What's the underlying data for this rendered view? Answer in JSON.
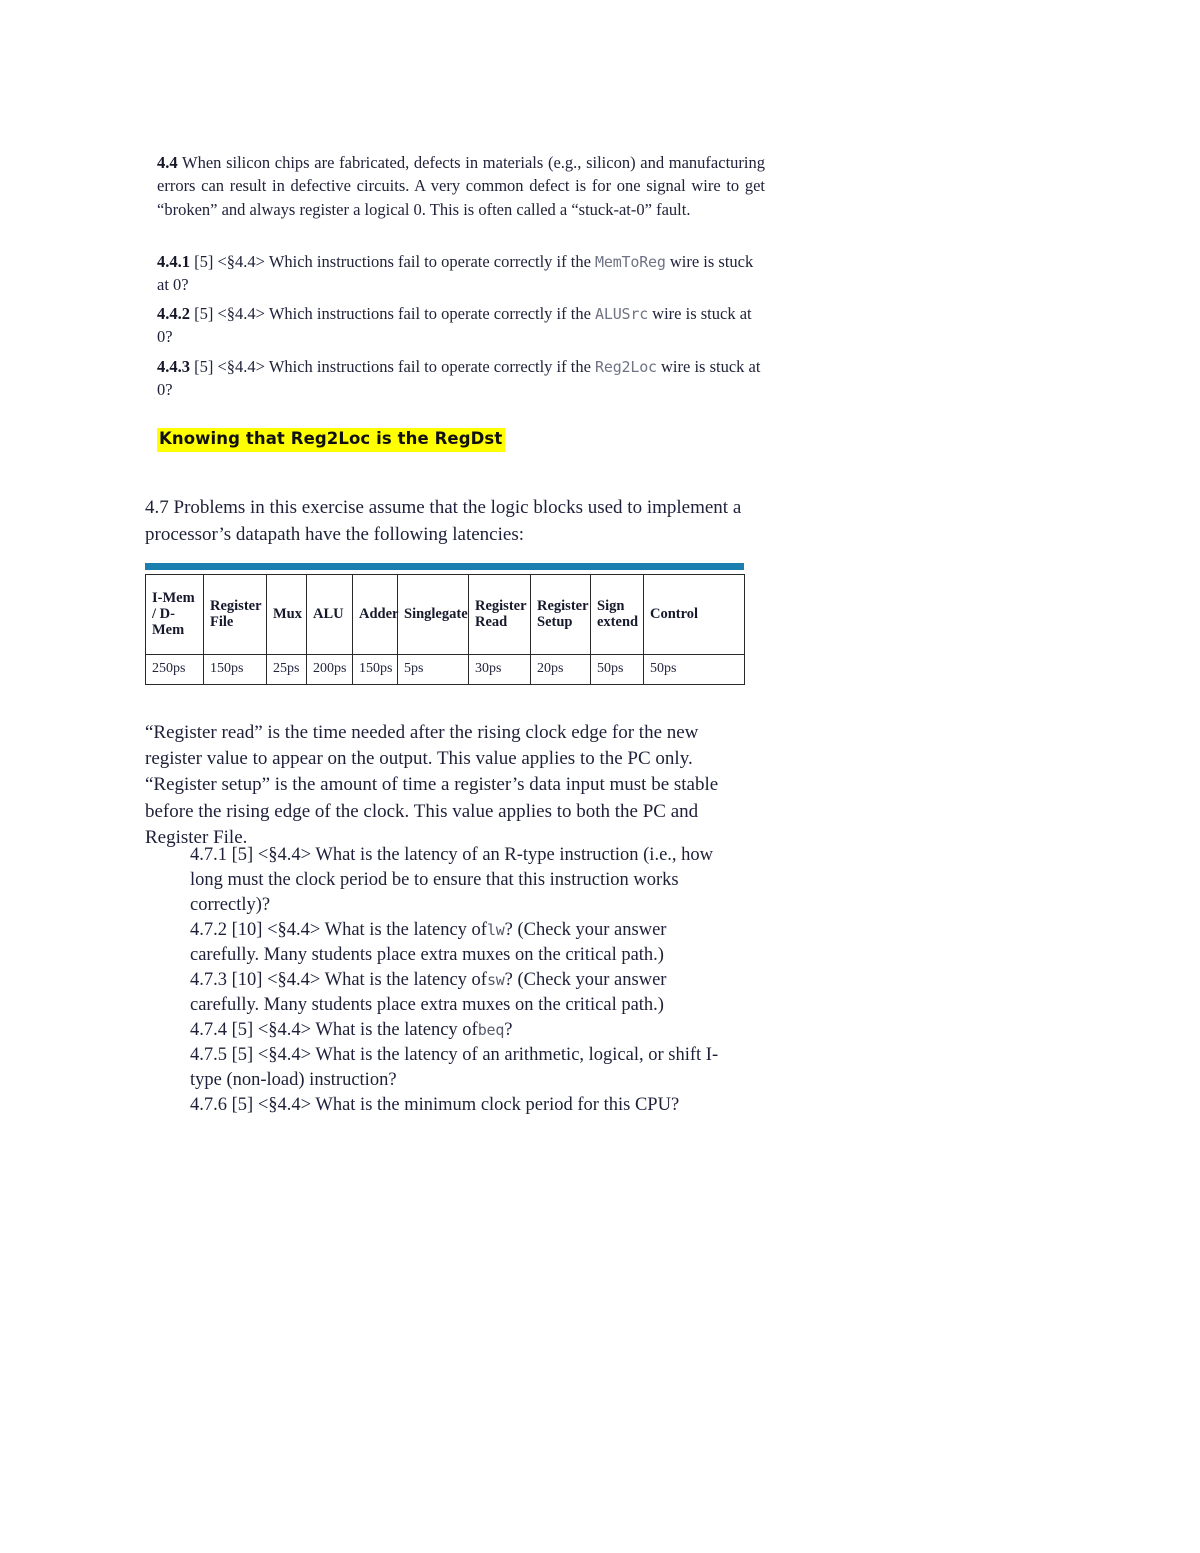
{
  "document": {
    "section_44": {
      "number": "4.4",
      "body": "When silicon chips are fabricated, defects in materials (e.g., silicon) and manufacturing errors can result in defective circuits. A very common defect is for one signal wire to get “broken” and always register a logical 0. This is often called a “stuck-at-0” fault."
    },
    "subquestions_44": [
      {
        "number": "4.4.1",
        "points": "[5]",
        "ref": "<§4.4>",
        "text_before": "Which instructions fail to operate correctly if the",
        "code": "MemToReg",
        "text_after": "wire is stuck at 0?"
      },
      {
        "number": "4.4.2",
        "points": "[5]",
        "ref": "<§4.4>",
        "text_before": "Which instructions fail to operate correctly if the",
        "code": "ALUSrc",
        "text_after": "wire is stuck at 0?"
      },
      {
        "number": "4.4.3",
        "points": "[5]",
        "ref": "<§4.4>",
        "text_before": "Which instructions fail to operate correctly if the",
        "code": "Reg2Loc",
        "text_after": "wire is stuck at 0?"
      }
    ],
    "annotation": {
      "text": "Knowing that Reg2Loc is the RegDst",
      "highlight_color": "#ffff00"
    },
    "section_47": {
      "intro": "4.7 Problems in this exercise assume that the logic blocks used to implement a processor’s datapath have the following latencies:",
      "paragraph": "“Register read” is the time needed after the rising clock edge for the new register value to appear on the output. This value applies to the PC only. “Register setup” is the amount of time a register’s data input must be stable before the rising edge of the clock. This value applies to both the PC and Register File."
    },
    "latency_table": {
      "accent_color": "#1a7eae",
      "headers": [
        "I-Mem / D-Mem",
        "Register File",
        "Mux",
        "ALU",
        "Adder",
        "Singlegate",
        "Register Read",
        "Register Setup",
        "Sign extend",
        "Control"
      ],
      "values": [
        "250ps",
        "150ps",
        "25ps",
        "200ps",
        "150ps",
        "5ps",
        "30ps",
        "20ps",
        "50ps",
        "50ps"
      ]
    },
    "subquestions_47": [
      {
        "number": "4.7.1",
        "points": "[5]",
        "ref": "<§4.4>",
        "text_before": "What is the latency of an R-type instruction (i.e., how long must the clock period be to ensure that this instruction works correctly)?",
        "code": "",
        "text_after": ""
      },
      {
        "number": "4.7.2",
        "points": "[10]",
        "ref": "<§4.4>",
        "text_before": "What is the latency of",
        "code": "lw",
        "text_after": "? (Check your answer carefully. Many students place extra muxes on the critical path.)"
      },
      {
        "number": "4.7.3",
        "points": "[10]",
        "ref": "<§4.4>",
        "text_before": "What is the latency of",
        "code": "sw",
        "text_after": "? (Check your answer carefully. Many students place extra muxes on the critical path.)"
      },
      {
        "number": "4.7.4",
        "points": "[5]",
        "ref": "<§4.4>",
        "text_before": "What is the latency of",
        "code": "beq",
        "text_after": "?"
      },
      {
        "number": "4.7.5",
        "points": "[5]",
        "ref": "<§4.4>",
        "text_before": "What is the latency of an arithmetic, logical, or shift I-type (non-load) instruction?",
        "code": "",
        "text_after": ""
      },
      {
        "number": "4.7.6",
        "points": "[5]",
        "ref": "<§4.4>",
        "text_before": "What is the minimum clock period for this CPU?",
        "code": "",
        "text_after": ""
      }
    ]
  }
}
